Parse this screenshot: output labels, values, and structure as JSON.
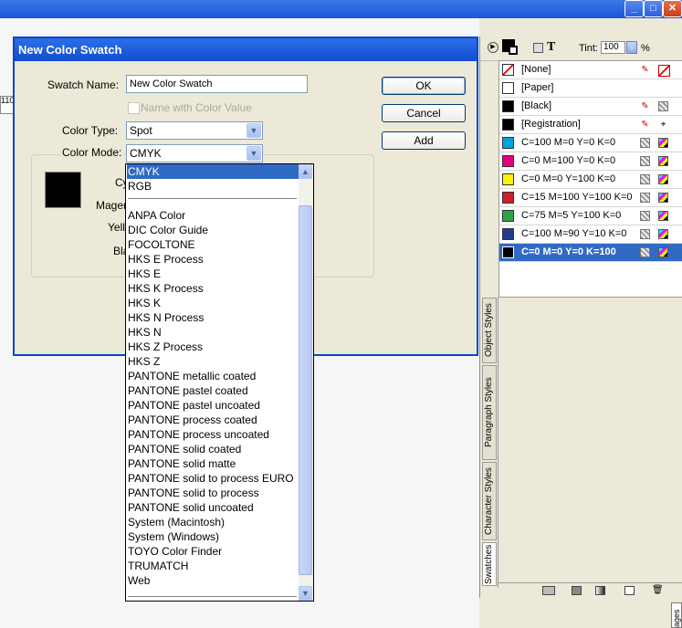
{
  "dialog": {
    "title": "New Color Swatch",
    "swatch_name_label": "Swatch Name:",
    "swatch_name_value": "New Color Swatch",
    "name_with_value_label": "Name with Color Value",
    "color_type_label": "Color Type:",
    "color_type_value": "Spot",
    "color_mode_label": "Color Mode:",
    "color_mode_value": "CMYK",
    "partial_labels": [
      "Cy",
      "Mager",
      "Yello",
      "Bla"
    ],
    "ok_label": "OK",
    "cancel_label": "Cancel",
    "add_label": "Add"
  },
  "dropdown": {
    "items": [
      "CMYK",
      "RGB",
      "ANPA Color",
      "DIC Color Guide",
      "FOCOLTONE",
      "HKS E Process",
      "HKS E",
      "HKS K Process",
      "HKS K",
      "HKS N Process",
      "HKS N",
      "HKS Z Process",
      "HKS Z",
      "PANTONE metallic coated",
      "PANTONE pastel coated",
      "PANTONE pastel uncoated",
      "PANTONE process coated",
      "PANTONE process uncoated",
      "PANTONE solid coated",
      "PANTONE solid matte",
      "PANTONE solid to process EURO",
      "PANTONE solid to process",
      "PANTONE solid uncoated",
      "System (Macintosh)",
      "System (Windows)",
      "TOYO Color Finder",
      "TRUMATCH",
      "Web"
    ],
    "selected": "CMYK"
  },
  "panel": {
    "tint_label": "Tint:",
    "tint_value": "100",
    "tint_unit": "%",
    "swatches": [
      {
        "name": "[None]",
        "color": "#ffffff"
      },
      {
        "name": "[Paper]",
        "color": "#ffffff"
      },
      {
        "name": "[Black]",
        "color": "#000000"
      },
      {
        "name": "[Registration]",
        "color": "#000000"
      },
      {
        "name": "C=100 M=0 Y=0 K=0",
        "color": "#00a3e0"
      },
      {
        "name": "C=0 M=100 Y=0 K=0",
        "color": "#e4007c"
      },
      {
        "name": "C=0 M=0 Y=100 K=0",
        "color": "#fff200"
      },
      {
        "name": "C=15 M=100 Y=100 K=0",
        "color": "#d0202a"
      },
      {
        "name": "C=75 M=5 Y=100 K=0",
        "color": "#2ea343"
      },
      {
        "name": "C=100 M=90 Y=10 K=0",
        "color": "#233b8e"
      },
      {
        "name": "C=0 M=0 Y=0 K=100",
        "color": "#000000"
      }
    ],
    "selected_swatch": "C=0 M=0 Y=0 K=100",
    "tabs": [
      "Object Styles",
      "Paragraph Styles",
      "Character Styles",
      "Swatches"
    ],
    "pages_tab": "ages",
    "ruler_text": "110"
  }
}
